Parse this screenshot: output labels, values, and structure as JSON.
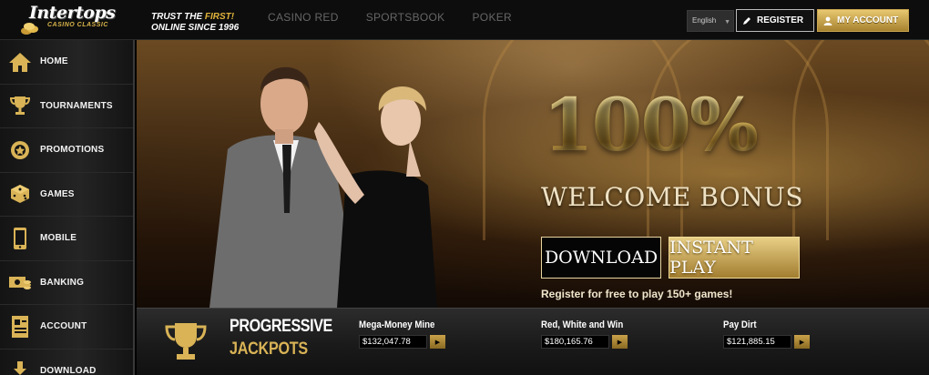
{
  "brand": {
    "logo_text": "Intertops",
    "logo_sub": "CASINO CLASSIC",
    "tagline_prefix": "TRUST THE ",
    "tagline_highlight": "FIRST!",
    "tagline_line2": "ONLINE SINCE 1996"
  },
  "topnav": [
    "CASINO RED",
    "SPORTSBOOK",
    "POKER"
  ],
  "header": {
    "language": "English",
    "register_label": "REGISTER",
    "account_label": "MY ACCOUNT"
  },
  "sidebar": {
    "items": [
      {
        "label": "HOME",
        "icon": "home-icon"
      },
      {
        "label": "TOURNAMENTS",
        "icon": "trophy-icon"
      },
      {
        "label": "PROMOTIONS",
        "icon": "badge-icon"
      },
      {
        "label": "GAMES",
        "icon": "dice-icon"
      },
      {
        "label": "MOBILE",
        "icon": "phone-icon"
      },
      {
        "label": "BANKING",
        "icon": "money-icon"
      },
      {
        "label": "ACCOUNT",
        "icon": "document-icon"
      },
      {
        "label": "DOWNLOAD",
        "icon": "download-icon"
      }
    ]
  },
  "hero": {
    "headline": "100%",
    "subheadline": "WELCOME BONUS",
    "download_label": "DOWNLOAD",
    "instant_label": "INSTANT PLAY",
    "note": "Register for free to play 150+ games!"
  },
  "jackpots": {
    "title_line1": "PROGRESSIVE",
    "title_line2": "JACKPOTS",
    "items": [
      {
        "name": "Mega-Money Mine",
        "value": "$132,047.78"
      },
      {
        "name": "Red, White and Win",
        "value": "$180,165.76"
      },
      {
        "name": "Pay Dirt",
        "value": "$121,885.15"
      }
    ]
  },
  "colors": {
    "gold": "#d9b356",
    "dark": "#0d0d0d"
  }
}
